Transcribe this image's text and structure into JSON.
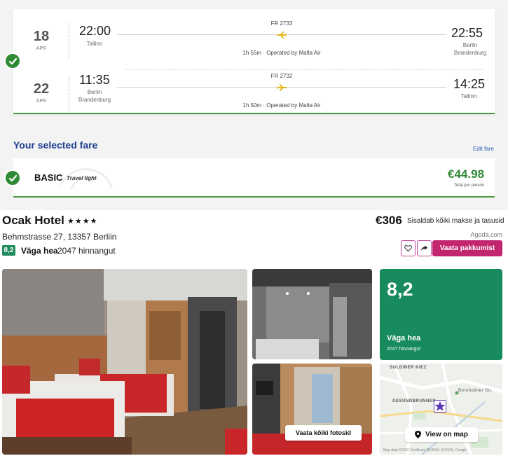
{
  "flight": {
    "outbound": {
      "day": "18",
      "month": "APR",
      "dep_time": "22:00",
      "dep_city": "Tallinn",
      "flight_no": "FR 2733",
      "duration": "1h 55m · Operated by Malta Air",
      "arr_time": "22:55",
      "arr_city_line1": "Berlin",
      "arr_city_line2": "Brandenburg"
    },
    "return": {
      "day": "22",
      "month": "APR",
      "dep_time": "11:35",
      "dep_city_line1": "Berlin",
      "dep_city_line2": "Brandenburg",
      "flight_no": "FR 2732",
      "duration": "1h 50m · Operated by Malta Air",
      "arr_time": "14:25",
      "arr_city": "Tallinn"
    }
  },
  "fare": {
    "section_title": "Your selected fare",
    "edit_label": "Edit fare",
    "name": "BASIC",
    "subtitle": "Travel light",
    "price": "€44.98",
    "price_note": "Total per person"
  },
  "hotel": {
    "name": "Ocak Hotel",
    "stars": "★★★★",
    "address": "Behmstrasse 27, 13357 Berliin",
    "rating": "8,2",
    "rating_word": "Väga hea",
    "review_count": "2047 hinnangut",
    "price": "€306",
    "price_note": "Sisaldab kõiki makse ja tasusid",
    "provider": "Agoda.com",
    "deal_button": "Vaata pakkumist",
    "all_photos_button": "Vaata kõiki fotosid",
    "score_tile": {
      "score": "8,2",
      "word": "Väga hea",
      "count": "2047 hinnangut"
    },
    "map": {
      "label_top": "SOLDINER KIEZ",
      "label_mid": "GESUNDBRUNNEN",
      "street": "Bornholmer Str.",
      "button": "View on map",
      "credit": "Map data ©2026 GeoBasis-DE/BKG (©2009), Google"
    }
  },
  "colors": {
    "brand_blue": "#1a3d8f",
    "green_check": "#2f8a36",
    "price_green": "#2f8a36",
    "deal_pink": "#c2266f",
    "score_green": "#178a5e",
    "rating_badge": "#1f8a5c"
  },
  "icons": {
    "check": "check-icon",
    "plane": "plane-icon",
    "heart": "heart-icon",
    "share": "share-icon",
    "pin": "map-pin-icon",
    "star_marker": "star-marker-icon"
  }
}
